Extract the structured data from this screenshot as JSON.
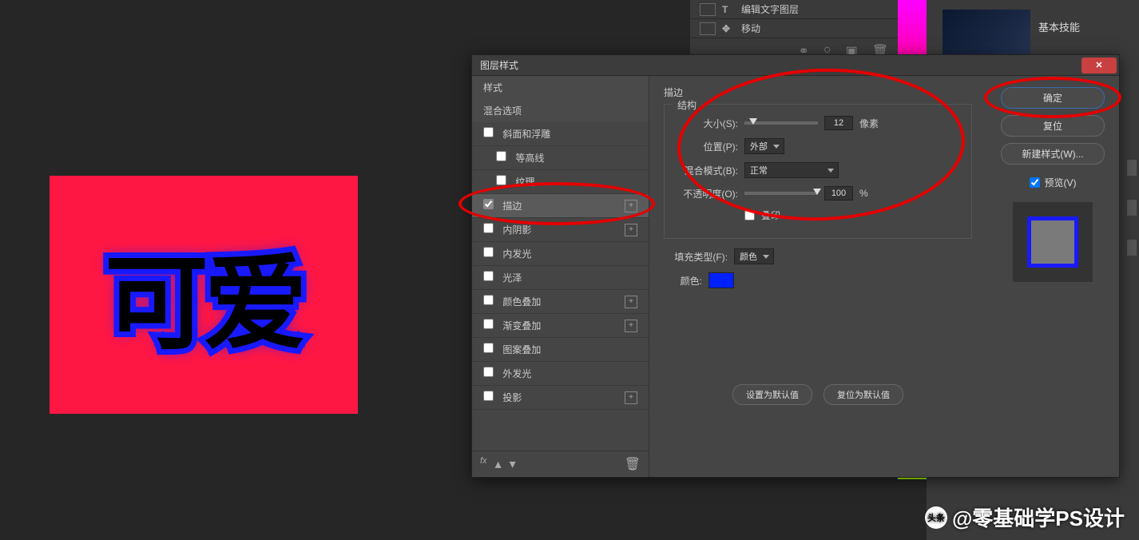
{
  "canvas": {
    "text": "可爱"
  },
  "bg_menu": {
    "item1": "编辑文字图层",
    "item2": "移动"
  },
  "right_panel": {
    "title": "基本技能"
  },
  "dialog": {
    "title": "图层样式",
    "styles_header": "样式",
    "blend_header": "混合选项",
    "items": {
      "bevel": "斜面和浮雕",
      "contour": "等高线",
      "texture": "纹理",
      "stroke": "描边",
      "inner_shadow": "内阴影",
      "inner_glow": "内发光",
      "satin": "光泽",
      "color_overlay": "颜色叠加",
      "gradient_overlay": "渐变叠加",
      "pattern_overlay": "图案叠加",
      "outer_glow": "外发光",
      "drop_shadow": "投影"
    },
    "fx_label": "fx",
    "section_title": "描边",
    "structure_legend": "结构",
    "size_label": "大小(S):",
    "size_value": "12",
    "size_unit": "像素",
    "position_label": "位置(P):",
    "position_value": "外部",
    "blend_mode_label": "混合模式(B):",
    "blend_mode_value": "正常",
    "opacity_label": "不透明度(O):",
    "opacity_value": "100",
    "opacity_unit": "%",
    "overprint_label": "叠印",
    "fill_type_label": "填充类型(F):",
    "fill_type_value": "颜色",
    "color_label": "颜色:",
    "btn_default": "设置为默认值",
    "btn_reset": "复位为默认值",
    "ok": "确定",
    "cancel": "复位",
    "new_style": "新建样式(W)...",
    "preview": "预览(V)"
  },
  "watermark": {
    "logo": "头条",
    "text": "@零基础学PS设计"
  }
}
